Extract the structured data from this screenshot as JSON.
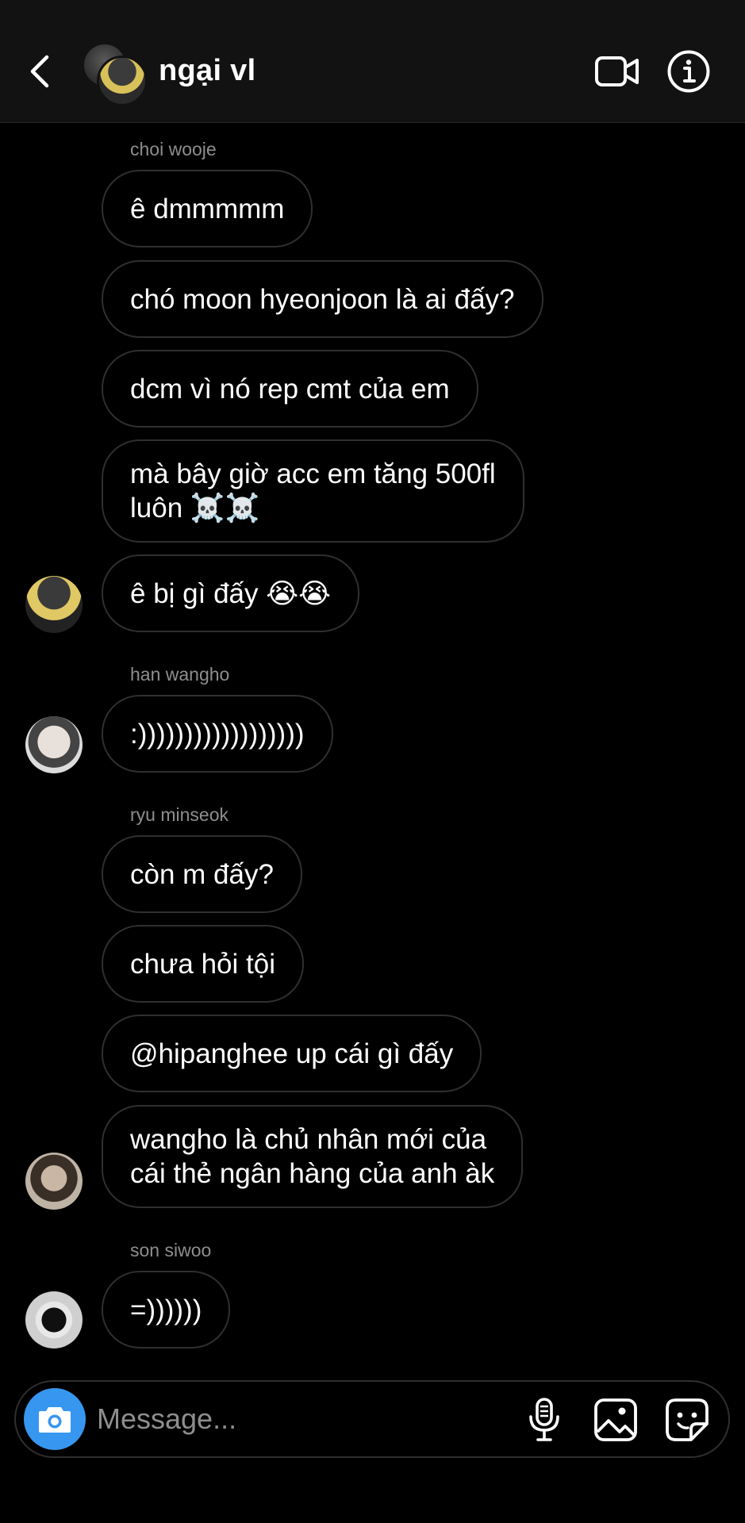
{
  "header": {
    "title": "ngại vl",
    "icons": {
      "back": "chevron-left-icon",
      "video": "video-camera-icon",
      "info": "info-icon"
    }
  },
  "messages": {
    "names": {
      "choi": "choi wooje",
      "han": "han wangho",
      "ryu": "ryu minseok",
      "son": "son siwoo"
    },
    "m1": "ê dmmmmm",
    "m2": "chó moon hyeonjoon là ai đấy?",
    "m3": "dcm vì nó rep cmt của em",
    "m4_line1": "mà bây giờ acc em tăng 500fl",
    "m4_line2": "luôn ☠️☠️",
    "m5": "ê bị gì đấy 😭😭",
    "m6": ":))))))))))))))))))",
    "m7": "còn m đấy?",
    "m8": "chưa hỏi tội",
    "m9": "@hipanghee up cái gì đấy",
    "m10_line1": "wangho là chủ nhân mới của",
    "m10_line2": "cái thẻ ngân hàng của anh àk",
    "m11": "=))))))"
  },
  "composer": {
    "placeholder": "Message...",
    "value": "",
    "accent": "#3797f0",
    "icons": {
      "camera": "camera-icon",
      "mic": "microphone-icon",
      "gallery": "image-gallery-icon",
      "sticker": "sticker-icon"
    }
  },
  "colors": {
    "background": "#000000",
    "header": "#121212",
    "bubble_border": "#2f2f2f",
    "sender_name": "#8e8e8e"
  }
}
